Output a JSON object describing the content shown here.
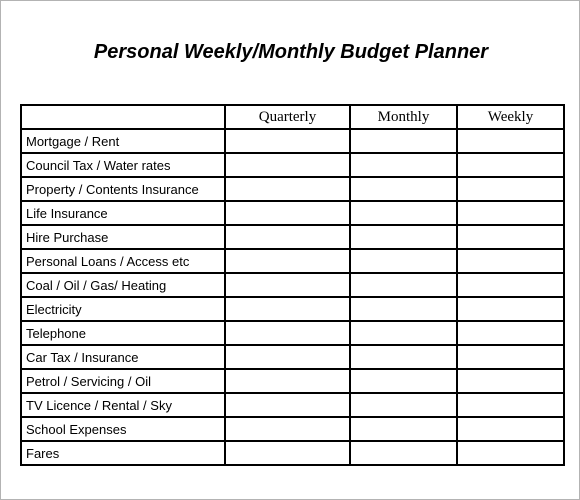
{
  "title": "Personal Weekly/Monthly Budget Planner",
  "table": {
    "columns": [
      "",
      "Quarterly",
      "Monthly",
      "Weekly"
    ],
    "rows": [
      {
        "label": "Mortgage  / Rent",
        "quarterly": "",
        "monthly": "",
        "weekly": ""
      },
      {
        "label": "Council Tax / Water rates",
        "quarterly": "",
        "monthly": "",
        "weekly": ""
      },
      {
        "label": "Property / Contents Insurance",
        "quarterly": "",
        "monthly": "",
        "weekly": ""
      },
      {
        "label": "Life Insurance",
        "quarterly": "",
        "monthly": "",
        "weekly": ""
      },
      {
        "label": "Hire Purchase",
        "quarterly": "",
        "monthly": "",
        "weekly": ""
      },
      {
        "label": "Personal Loans / Access etc",
        "quarterly": "",
        "monthly": "",
        "weekly": ""
      },
      {
        "label": "Coal / Oil / Gas/ Heating",
        "quarterly": "",
        "monthly": "",
        "weekly": ""
      },
      {
        "label": "Electricity",
        "quarterly": "",
        "monthly": "",
        "weekly": ""
      },
      {
        "label": "Telephone",
        "quarterly": "",
        "monthly": "",
        "weekly": ""
      },
      {
        "label": "Car Tax  / Insurance",
        "quarterly": "",
        "monthly": "",
        "weekly": ""
      },
      {
        "label": "Petrol / Servicing / Oil",
        "quarterly": "",
        "monthly": "",
        "weekly": ""
      },
      {
        "label": "TV Licence / Rental / Sky",
        "quarterly": "",
        "monthly": "",
        "weekly": ""
      },
      {
        "label": "School Expenses",
        "quarterly": "",
        "monthly": "",
        "weekly": ""
      },
      {
        "label": "Fares",
        "quarterly": "",
        "monthly": "",
        "weekly": ""
      }
    ]
  }
}
